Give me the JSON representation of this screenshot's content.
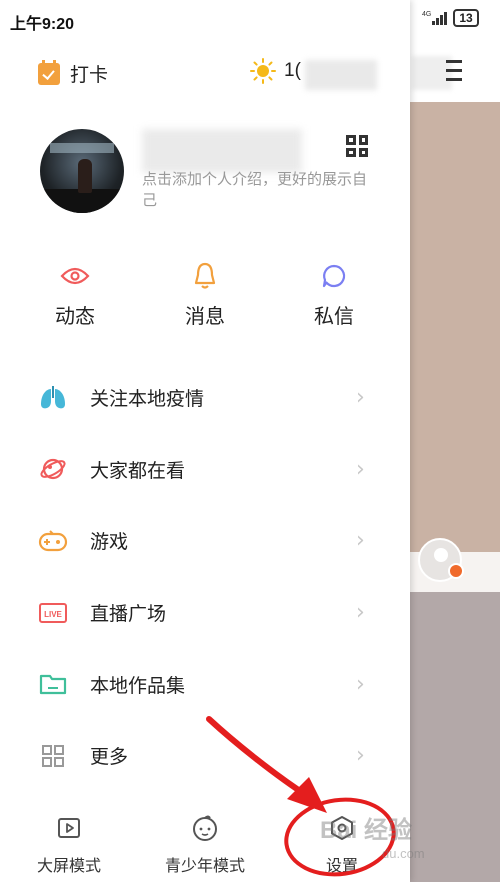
{
  "status_bar": {
    "time": "上午9:20",
    "network": "4G",
    "battery": "13"
  },
  "top": {
    "checkin_label": "打卡",
    "temperature": "1("
  },
  "profile": {
    "bio": "点击添加个人介绍，更好的展示自己"
  },
  "quick_actions": [
    {
      "label": "动态",
      "icon": "eye-icon",
      "color": "#f05b5b"
    },
    {
      "label": "消息",
      "icon": "bell-icon",
      "color": "#f2a03d"
    },
    {
      "label": "私信",
      "icon": "chat-bubble-icon",
      "color": "#7b7ff2"
    }
  ],
  "menu": [
    {
      "label": "关注本地疫情",
      "icon": "lungs-icon"
    },
    {
      "label": "大家都在看",
      "icon": "planet-icon"
    },
    {
      "label": "游戏",
      "icon": "gamepad-icon"
    },
    {
      "label": "直播广场",
      "icon": "live-icon"
    },
    {
      "label": "本地作品集",
      "icon": "folder-icon"
    },
    {
      "label": "更多",
      "icon": "grid-icon"
    }
  ],
  "bottom_bar": [
    {
      "label": "大屏模式",
      "icon": "play-screen-icon"
    },
    {
      "label": "青少年模式",
      "icon": "child-face-icon"
    },
    {
      "label": "设置",
      "icon": "settings-hex-icon"
    }
  ],
  "chevron": "›",
  "watermark": {
    "text": "Bai 经验",
    "sub": "du.com"
  },
  "colors": {
    "annotation": "#e41e1e",
    "checkin": "#f2a03d",
    "sun": "#f5b919"
  }
}
